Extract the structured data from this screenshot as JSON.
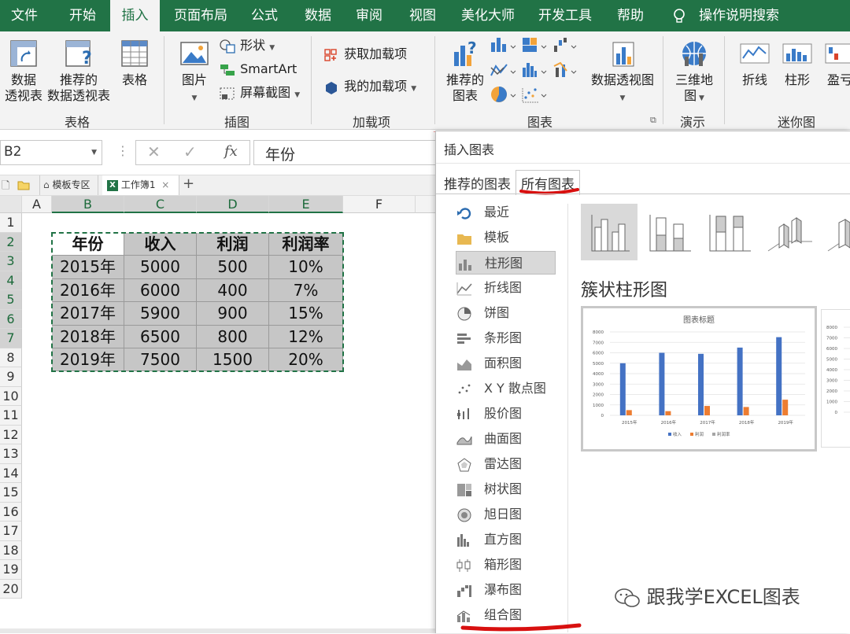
{
  "menu": {
    "tabs": [
      "文件",
      "开始",
      "插入",
      "页面布局",
      "公式",
      "数据",
      "审阅",
      "视图",
      "美化大师",
      "开发工具",
      "帮助"
    ],
    "active": "插入",
    "tell_me": "操作说明搜索"
  },
  "ribbon": {
    "groups": {
      "tables": "表格",
      "illustrations": "插图",
      "addins": "加载项",
      "charts": "图表",
      "tours": "演示",
      "sparklines": "迷你图"
    },
    "pivot_line1": "数据",
    "pivot_line2": "透视表",
    "rec_pivot_line1": "推荐的",
    "rec_pivot_line2": "数据透视表",
    "table": "表格",
    "pictures": "图片",
    "shapes": "形状",
    "smartart": "SmartArt",
    "screenshot": "屏幕截图",
    "get_addins": "获取加载项",
    "my_addins": "我的加载项",
    "rec_charts_line1": "推荐的",
    "rec_charts_line2": "图表",
    "pivot_chart": "数据透视图",
    "map3d_line1": "三维地",
    "map3d_line2": "图",
    "spark_line": "折线",
    "spark_column": "柱形",
    "spark_winloss": "盈亏"
  },
  "formula": {
    "namebox": "B2",
    "fx": "fx",
    "content": "年份"
  },
  "tabs_row": {
    "template": "模板专区",
    "workbook": "工作簿1",
    "add": "+"
  },
  "sheet": {
    "columns": [
      "A",
      "B",
      "C",
      "D",
      "E",
      "F"
    ],
    "rows": [
      "1",
      "2",
      "3",
      "4",
      "5",
      "6",
      "7",
      "8",
      "9",
      "10",
      "11",
      "12",
      "13",
      "14",
      "15",
      "16",
      "17",
      "18",
      "19",
      "20"
    ],
    "table": [
      [
        "年份",
        "收入",
        "利润",
        "利润率"
      ],
      [
        "2015年",
        "5000",
        "500",
        "10%"
      ],
      [
        "2016年",
        "6000",
        "400",
        "7%"
      ],
      [
        "2017年",
        "5900",
        "900",
        "15%"
      ],
      [
        "2018年",
        "6500",
        "800",
        "12%"
      ],
      [
        "2019年",
        "7500",
        "1500",
        "20%"
      ]
    ]
  },
  "dialog": {
    "title": "插入图表",
    "tab_recommended": "推荐的图表",
    "tab_all": "所有图表",
    "types": [
      "最近",
      "模板",
      "柱形图",
      "折线图",
      "饼图",
      "条形图",
      "面积图",
      "X Y 散点图",
      "股价图",
      "曲面图",
      "雷达图",
      "树状图",
      "旭日图",
      "直方图",
      "箱形图",
      "瀑布图",
      "组合图"
    ],
    "selected_type": "柱形图",
    "subtype_title": "簇状柱形图",
    "preview_title": "图表标题"
  },
  "watermark": "跟我学EXCEL图表",
  "chart_data": {
    "type": "bar",
    "title": "图表标题",
    "categories": [
      "2015年",
      "2016年",
      "2017年",
      "2018年",
      "2019年"
    ],
    "series": [
      {
        "name": "收入",
        "values": [
          5000,
          6000,
          5900,
          6500,
          7500
        ],
        "color": "#4472c4"
      },
      {
        "name": "利润",
        "values": [
          500,
          400,
          900,
          800,
          1500
        ],
        "color": "#ed7d31"
      },
      {
        "name": "利润率",
        "values": [
          0.1,
          0.07,
          0.15,
          0.12,
          0.2
        ],
        "color": "#a5a5a5"
      }
    ],
    "ylim": [
      0,
      8000
    ],
    "yticks": [
      "0",
      "1000",
      "2000",
      "3000",
      "4000",
      "5000",
      "6000",
      "7000",
      "8000"
    ],
    "legend": "bottom",
    "grid": true
  }
}
